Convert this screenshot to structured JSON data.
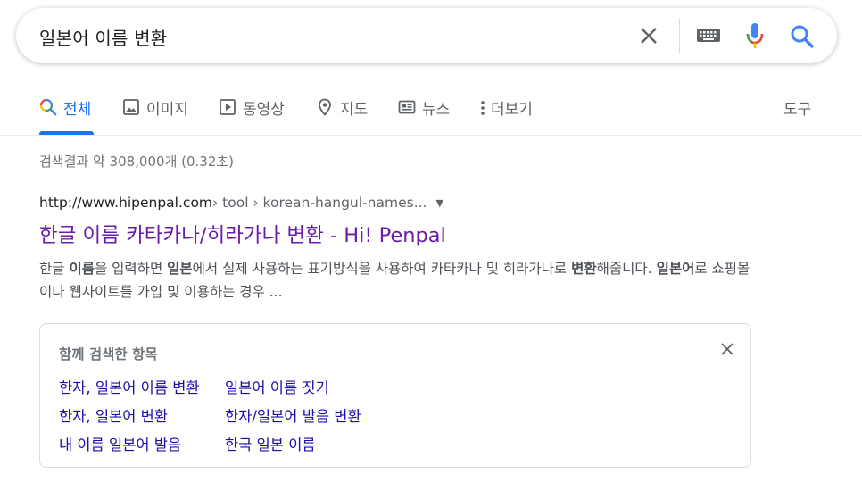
{
  "search": {
    "query": "일본어 이름 변환"
  },
  "tabs": [
    {
      "label": "전체",
      "icon": "search-multicolor-icon",
      "active": true
    },
    {
      "label": "이미지",
      "icon": "image-icon"
    },
    {
      "label": "동영상",
      "icon": "video-play-icon"
    },
    {
      "label": "지도",
      "icon": "map-pin-icon"
    },
    {
      "label": "뉴스",
      "icon": "newspaper-icon"
    },
    {
      "label": "더보기",
      "icon": "more-vert-icon"
    }
  ],
  "tools_label": "도구",
  "stats": "검색결과 약 308,000개 (0.32초)",
  "result": {
    "cite_domain": "http://www.hipenpal.com",
    "cite_path": " › tool › korean-hangul-names...",
    "title": "한글 이름 카타카나/히라가나 변환 - Hi! Penpal",
    "snippet": [
      {
        "t": "한글 ",
        "b": false
      },
      {
        "t": "이름",
        "b": true
      },
      {
        "t": "을 입력하면 ",
        "b": false
      },
      {
        "t": "일본",
        "b": true
      },
      {
        "t": "에서 실제 사용하는 표기방식을 사용하여 카타카나 및 히라가나로 ",
        "b": false
      },
      {
        "t": "변환",
        "b": true
      },
      {
        "t": "해줍니다. ",
        "b": false
      },
      {
        "t": "일본어",
        "b": true
      },
      {
        "t": "로 쇼핑몰이나 웹사이트를 가입 및 이용하는 경우 ...",
        "b": false
      }
    ]
  },
  "related": {
    "title": "함께 검색한 항목",
    "links": [
      "한자, 일본어 이름 변환",
      "일본어 이름 짓기",
      "한자, 일본어 변환",
      "한자/일본어 발음 변환",
      "내 이름 일본어 발음",
      "한국 일본 이름"
    ]
  },
  "colors": {
    "accent": "#1a73e8",
    "visited_title": "#681da8",
    "link": "#1a0dab",
    "muted": "#70757a"
  }
}
